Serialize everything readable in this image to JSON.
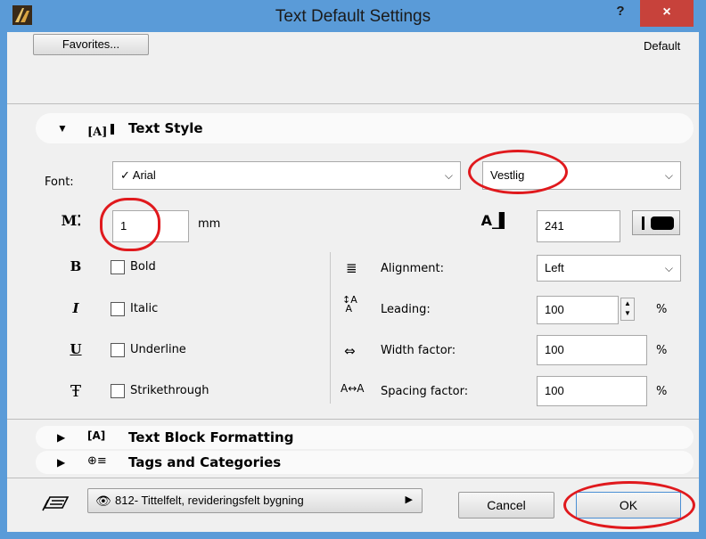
{
  "window": {
    "title": "Text Default Settings",
    "help_label": "?",
    "close_label": "×"
  },
  "toolbar": {
    "favorites_label": "Favorites...",
    "default_label": "Default"
  },
  "sections": {
    "text_style": "Text Style",
    "text_block": "Text Block Formatting",
    "tags": "Tags and Categories"
  },
  "font": {
    "label": "Font:",
    "value": "✓ Arial",
    "script": "Vestlig"
  },
  "size": {
    "value": "1",
    "unit": "mm"
  },
  "pen": {
    "value": "241"
  },
  "styles": {
    "bold": "Bold",
    "italic": "Italic",
    "underline": "Underline",
    "strikethrough": "Strikethrough"
  },
  "props": {
    "alignment_label": "Alignment:",
    "alignment_value": "Left",
    "leading_label": "Leading:",
    "leading_value": "100",
    "width_label": "Width factor:",
    "width_value": "100",
    "spacing_label": "Spacing factor:",
    "spacing_value": "100",
    "percent": "%"
  },
  "footer": {
    "layer": "812- Tittelfelt, revideringsfelt bygning",
    "cancel_label": "Cancel",
    "ok_label": "OK"
  },
  "icons": [
    "app-icon",
    "text-style-icon",
    "text-block-icon",
    "tags-icon",
    "font-size-icon",
    "pen-icon",
    "bold-icon",
    "italic-icon",
    "underline-icon",
    "strikethrough-icon",
    "alignment-icon",
    "leading-icon",
    "width-factor-icon",
    "spacing-factor-icon",
    "layer-icon",
    "eye-icon"
  ],
  "colors": {
    "title_bar": "#5a9bd8",
    "close": "#c7423b",
    "highlight": "#e0191d"
  }
}
